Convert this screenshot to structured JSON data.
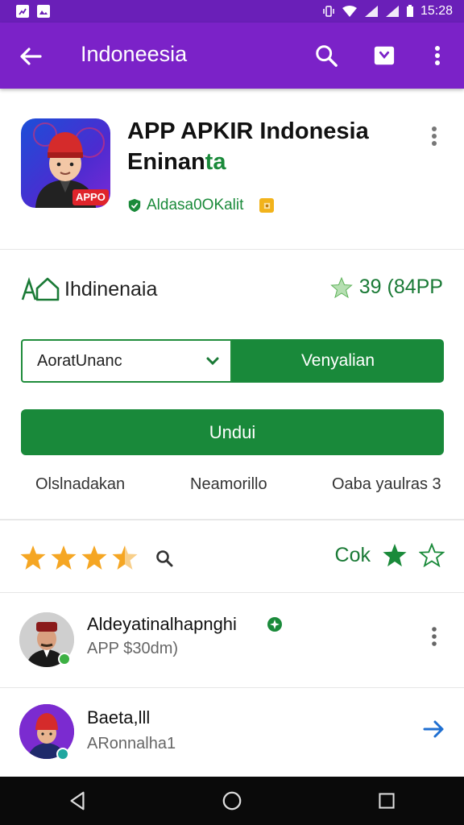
{
  "status_bar": {
    "time": "15:28"
  },
  "app_bar": {
    "title": "Indoneesia"
  },
  "app": {
    "title_line1": "APP APKIR Indonesia",
    "title_line2_a": "Eninan",
    "title_line2_b": "ta",
    "icon_label": "APPO",
    "developer": "Aldasa0OKalit"
  },
  "meta": {
    "country": "Ihdinenaia",
    "rating": "39 (84PP"
  },
  "actions": {
    "dropdown_value": "AoratUnanc",
    "secondary_button": "Venyalian",
    "primary_button": "Undui"
  },
  "links": [
    "Olslnadakan",
    "Neamorillo",
    "Oaba yaulras 3"
  ],
  "rate": {
    "stars": 3.5,
    "label": "Cok"
  },
  "reviews": [
    {
      "name": "Aldeyatinalhapnghi",
      "subtitle": "APP $30dm)"
    },
    {
      "name": "Baeta,lll",
      "subtitle": "ARonnalha1"
    }
  ],
  "colors": {
    "toolbar_purple": "#7b22c8",
    "status_purple": "#6a1fb8",
    "accent_green": "#19893a",
    "star_orange": "#f5a623"
  }
}
